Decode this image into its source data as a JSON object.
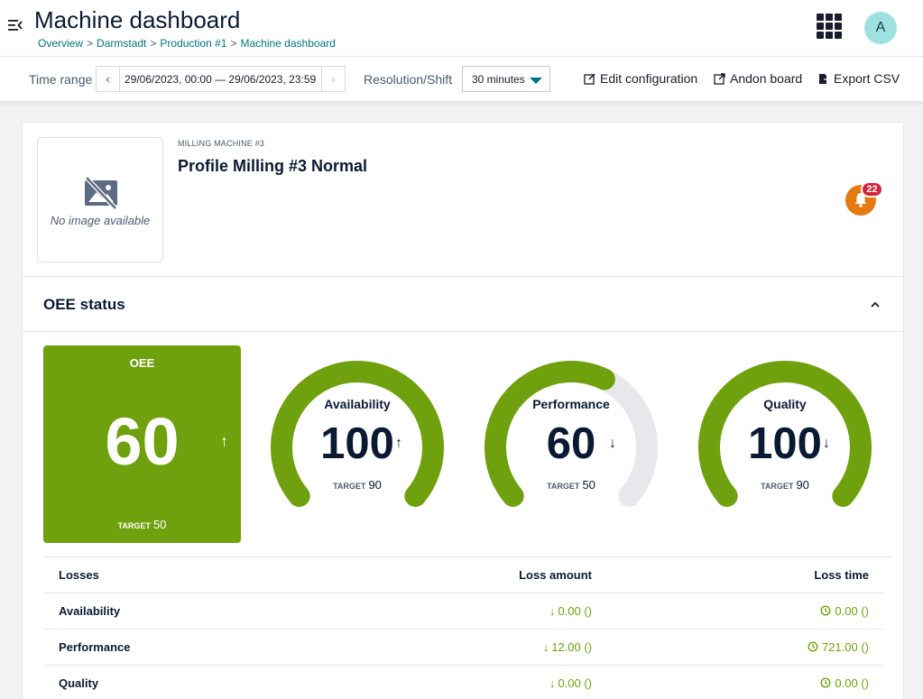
{
  "header": {
    "title": "Machine dashboard",
    "breadcrumb": [
      "Overview",
      "Darmstadt",
      "Production #1",
      "Machine dashboard"
    ],
    "avatar_initial": "A"
  },
  "toolbar": {
    "time_range_label": "Time range",
    "time_range_value": "29/06/2023, 00:00 — 29/06/2023, 23:59",
    "resolution_label": "Resolution/Shift",
    "resolution_value": "30 minutes",
    "edit_label": "Edit configuration",
    "andon_label": "Andon board",
    "export_label": "Export CSV"
  },
  "machine": {
    "subtitle": "MILLING MACHINE #3",
    "name": "Profile Milling #3 Normal",
    "no_image_text": "No image available",
    "alert_count": "22"
  },
  "oee_status": {
    "title": "OEE status",
    "oee": {
      "label": "OEE",
      "value": "60",
      "target_label": "TARGET",
      "target": "50",
      "trend": "↑"
    },
    "gauges": [
      {
        "label": "Availability",
        "value": "100",
        "target_label": "TARGET",
        "target": "90",
        "trend": "↑",
        "fraction": 1.0
      },
      {
        "label": "Performance",
        "value": "60",
        "target_label": "TARGET",
        "target": "50",
        "trend": "↓",
        "fraction": 0.6
      },
      {
        "label": "Quality",
        "value": "100",
        "target_label": "TARGET",
        "target": "90",
        "trend": "↓",
        "fraction": 1.0
      }
    ],
    "gauge_color": "#6fa10e",
    "gauge_track_color": "#e6e8ec"
  },
  "losses": {
    "headers": {
      "losses": "Losses",
      "amount": "Loss amount",
      "time": "Loss time"
    },
    "rows": [
      {
        "name": "Availability",
        "amount": "0.00 ()",
        "time": "0.00 ()"
      },
      {
        "name": "Performance",
        "amount": "12.00 ()",
        "time": "721.00 ()"
      },
      {
        "name": "Quality",
        "amount": "0.00 ()",
        "time": "0.00 ()"
      }
    ]
  }
}
